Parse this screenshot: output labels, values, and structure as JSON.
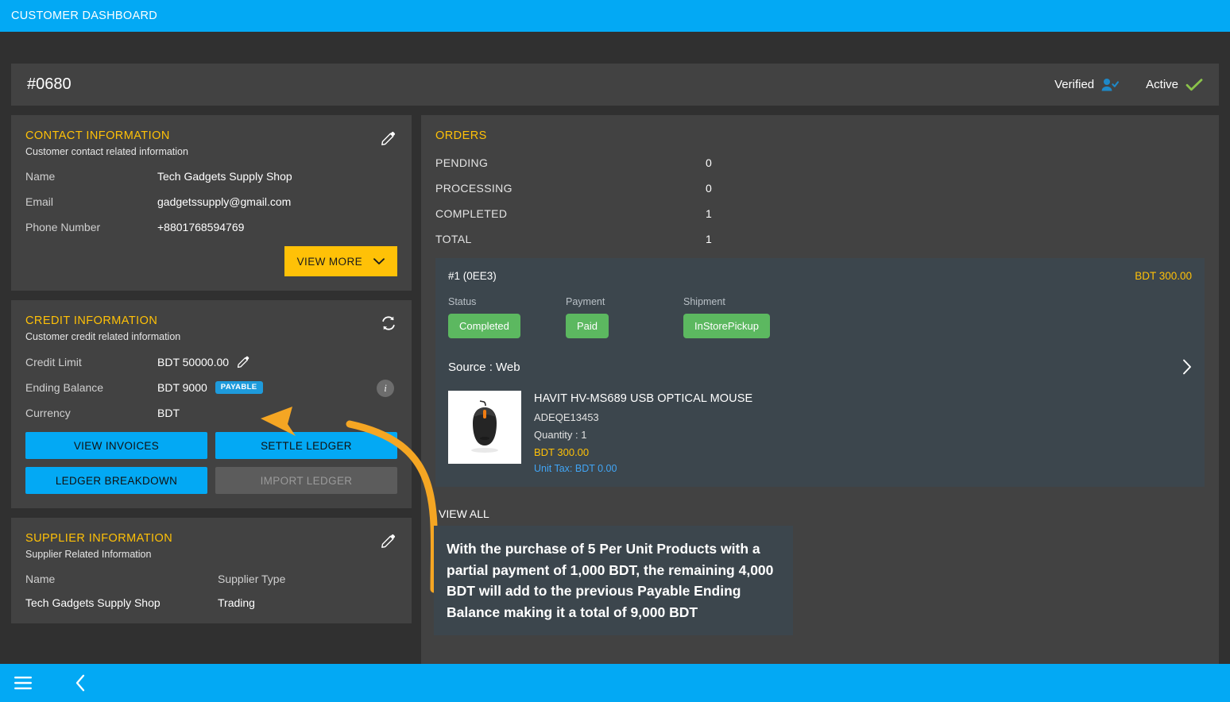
{
  "topbar": {
    "title": "CUSTOMER DASHBOARD"
  },
  "header": {
    "customer_id": "#0680",
    "verified_label": "Verified",
    "active_label": "Active",
    "verified_icon": "user-check-icon",
    "active_icon": "check-icon"
  },
  "contact": {
    "title": "CONTACT INFORMATION",
    "subtitle": "Customer contact related information",
    "edit_icon": "pencil-icon",
    "rows": [
      {
        "label": "Name",
        "value": "Tech Gadgets Supply Shop"
      },
      {
        "label": "Email",
        "value": "gadgetssupply@gmail.com"
      },
      {
        "label": "Phone Number",
        "value": "+8801768594769"
      }
    ],
    "view_more_label": "VIEW MORE"
  },
  "credit": {
    "title": "CREDIT INFORMATION",
    "subtitle": "Customer credit related information",
    "refresh_icon": "refresh-icon",
    "info_icon": "info-icon",
    "credit_limit_label": "Credit Limit",
    "credit_limit_value": "BDT 50000.00",
    "ending_balance_label": "Ending Balance",
    "ending_balance_value": "BDT 9000",
    "ending_balance_badge": "PAYABLE",
    "currency_label": "Currency",
    "currency_value": "BDT",
    "buttons": [
      {
        "label": "VIEW INVOICES",
        "disabled": false
      },
      {
        "label": "SETTLE LEDGER",
        "disabled": false
      },
      {
        "label": "LEDGER BREAKDOWN",
        "disabled": false
      },
      {
        "label": "IMPORT LEDGER",
        "disabled": true
      }
    ]
  },
  "supplier": {
    "title": "SUPPLIER INFORMATION",
    "subtitle": "Supplier Related Information",
    "edit_icon": "pencil-icon",
    "col_name": "Name",
    "col_type": "Supplier Type",
    "val_name": "Tech Gadgets Supply Shop",
    "val_type": "Trading"
  },
  "orders": {
    "title": "ORDERS",
    "summary": [
      {
        "label": "PENDING",
        "value": "0"
      },
      {
        "label": "PROCESSING",
        "value": "0"
      },
      {
        "label": "COMPLETED",
        "value": "1"
      },
      {
        "label": "TOTAL",
        "value": "1"
      }
    ],
    "order": {
      "id": "#1 (0EE3)",
      "amount": "BDT 300.00",
      "status_label": "Status",
      "payment_label": "Payment",
      "shipment_label": "Shipment",
      "status_value": "Completed",
      "payment_value": "Paid",
      "shipment_value": "InStorePickup",
      "source": "Source : Web",
      "chevron_icon": "chevron-right-icon",
      "product": {
        "name": "HAVIT HV-MS689 USB OPTICAL MOUSE",
        "sku": "ADEQE13453",
        "quantity": "Quantity : 1",
        "price": "BDT 300.00",
        "tax": "Unit Tax: BDT 0.00",
        "thumb_icon": "computer-mouse-image"
      }
    },
    "view_all_label": "VIEW ALL"
  },
  "annotation": {
    "text": "With the purchase of 5 Per Unit Products with a partial payment of 1,000 BDT, the remaining 4,000 BDT will add to the previous Payable Ending Balance making it a total of 9,000 BDT",
    "arrow_color": "#f5a623"
  },
  "bottombar": {
    "menu_icon": "hamburger-menu-icon",
    "back_icon": "chevron-left-icon"
  },
  "colors": {
    "accent_blue": "#03a9f4",
    "card_bg": "#424242",
    "page_bg": "#303030",
    "amber": "#ffc107",
    "green": "#5cb860",
    "order_box": "#3c464d"
  }
}
